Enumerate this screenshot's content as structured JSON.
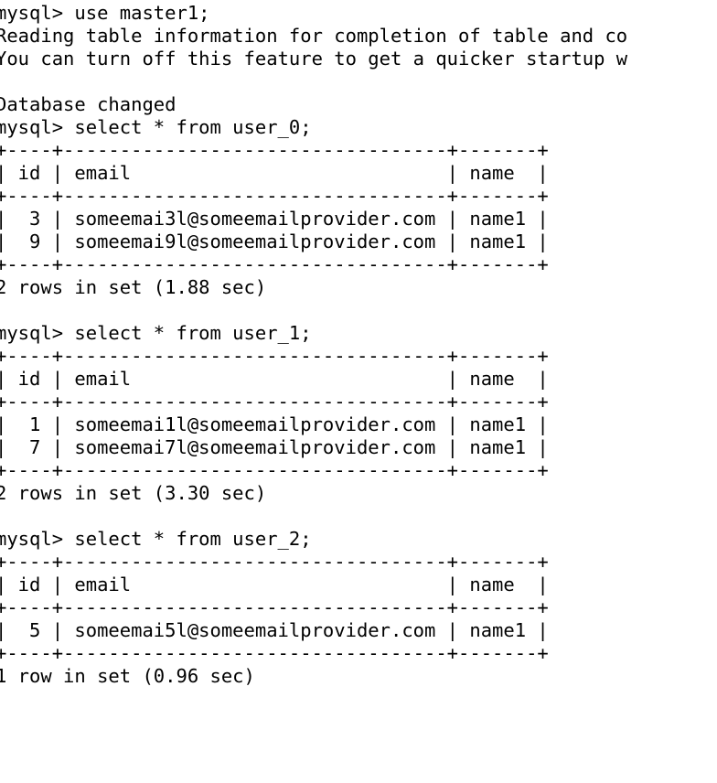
{
  "terminal": {
    "background_color": "#ffffff",
    "foreground_color": "#000000",
    "prompt": "mysql>",
    "font_size_px": 20,
    "line_height_px": 25,
    "columns_visible": 46
  },
  "session": {
    "database": "master1",
    "lines": [
      {
        "id": "l01",
        "type": "prompt",
        "text": "mysql> use master1;"
      },
      {
        "id": "l02",
        "type": "output",
        "text": "Reading table information for completion of table and co"
      },
      {
        "id": "l03",
        "type": "output",
        "text": "You can turn off this feature to get a quicker startup w"
      },
      {
        "id": "l04",
        "type": "blank",
        "text": ""
      },
      {
        "id": "l05",
        "type": "output",
        "text": "Database changed"
      },
      {
        "id": "l06",
        "type": "prompt",
        "text": "mysql> select * from user_0;"
      },
      {
        "id": "l07",
        "type": "separator",
        "text": "+----+----------------------------------+-------+"
      },
      {
        "id": "l08",
        "type": "header",
        "text": "| id | email                            | name  |"
      },
      {
        "id": "l09",
        "type": "separator",
        "text": "+----+----------------------------------+-------+"
      },
      {
        "id": "l10",
        "type": "row",
        "text": "|  3 | someemai3l@someemailprovider.com | name1 |"
      },
      {
        "id": "l11",
        "type": "row",
        "text": "|  9 | someemai9l@someemailprovider.com | name1 |"
      },
      {
        "id": "l12",
        "type": "separator",
        "text": "+----+----------------------------------+-------+"
      },
      {
        "id": "l13",
        "type": "status",
        "text": "2 rows in set (1.88 sec)"
      },
      {
        "id": "l14",
        "type": "blank",
        "text": ""
      },
      {
        "id": "l15",
        "type": "prompt",
        "text": "mysql> select * from user_1;"
      },
      {
        "id": "l16",
        "type": "separator",
        "text": "+----+----------------------------------+-------+"
      },
      {
        "id": "l17",
        "type": "header",
        "text": "| id | email                            | name  |"
      },
      {
        "id": "l18",
        "type": "separator",
        "text": "+----+----------------------------------+-------+"
      },
      {
        "id": "l19",
        "type": "row",
        "text": "|  1 | someemai1l@someemailprovider.com | name1 |"
      },
      {
        "id": "l20",
        "type": "row",
        "text": "|  7 | someemai7l@someemailprovider.com | name1 |"
      },
      {
        "id": "l21",
        "type": "separator",
        "text": "+----+----------------------------------+-------+"
      },
      {
        "id": "l22",
        "type": "status",
        "text": "2 rows in set (3.30 sec)"
      },
      {
        "id": "l23",
        "type": "blank",
        "text": ""
      },
      {
        "id": "l24",
        "type": "prompt",
        "text": "mysql> select * from user_2;"
      },
      {
        "id": "l25",
        "type": "separator",
        "text": "+----+----------------------------------+-------+"
      },
      {
        "id": "l26",
        "type": "header",
        "text": "| id | email                            | name  |"
      },
      {
        "id": "l27",
        "type": "separator",
        "text": "+----+----------------------------------+-------+"
      },
      {
        "id": "l28",
        "type": "row",
        "text": "|  5 | someemai5l@someemailprovider.com | name1 |"
      },
      {
        "id": "l29",
        "type": "separator",
        "text": "+----+----------------------------------+-------+"
      },
      {
        "id": "l30",
        "type": "status",
        "text": "1 row in set (0.96 sec)"
      }
    ]
  },
  "commands": [
    {
      "text": "use master1;",
      "result": "Database changed"
    },
    {
      "text": "select * from user_0;",
      "result": "2 rows in set (1.88 sec)"
    },
    {
      "text": "select * from user_1;",
      "result": "2 rows in set (3.30 sec)"
    },
    {
      "text": "select * from user_2;",
      "result": "1 row in set (0.96 sec)"
    }
  ],
  "result_sets": [
    {
      "table": "user_0",
      "columns": [
        "id",
        "email",
        "name"
      ],
      "rows": [
        [
          "3",
          "someemai3l@someemailprovider.com",
          "name1"
        ],
        [
          "9",
          "someemai9l@someemailprovider.com",
          "name1"
        ]
      ],
      "status": "2 rows in set (1.88 sec)",
      "row_count": 2,
      "elapsed_sec": 1.88
    },
    {
      "table": "user_1",
      "columns": [
        "id",
        "email",
        "name"
      ],
      "rows": [
        [
          "1",
          "someemai1l@someemailprovider.com",
          "name1"
        ],
        [
          "7",
          "someemai7l@someemailprovider.com",
          "name1"
        ]
      ],
      "status": "2 rows in set (3.30 sec)",
      "row_count": 2,
      "elapsed_sec": 3.3
    },
    {
      "table": "user_2",
      "columns": [
        "id",
        "email",
        "name"
      ],
      "rows": [
        [
          "5",
          "someemai5l@someemailprovider.com",
          "name1"
        ]
      ],
      "status": "1 row in set (0.96 sec)",
      "row_count": 1,
      "elapsed_sec": 0.96
    }
  ]
}
